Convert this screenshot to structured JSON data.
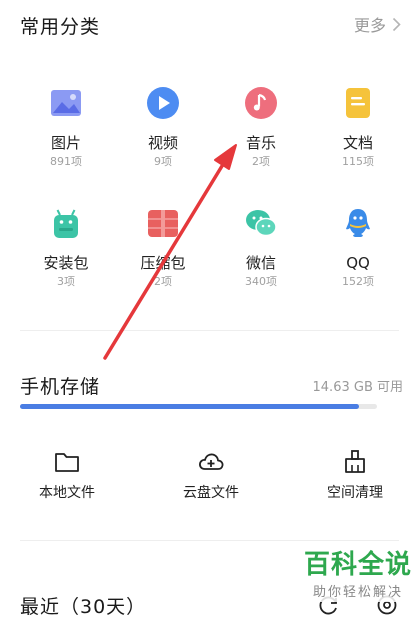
{
  "categories": {
    "title": "常用分类",
    "more_label": "更多",
    "items": [
      {
        "label": "图片",
        "count": "891项",
        "color": "#7a8cf0"
      },
      {
        "label": "视频",
        "count": "9项",
        "color": "#4d8cf2"
      },
      {
        "label": "音乐",
        "count": "2项",
        "color": "#ef5b6c"
      },
      {
        "label": "文档",
        "count": "115项",
        "color": "#f5c33b"
      },
      {
        "label": "安装包",
        "count": "3项",
        "color": "#3cc4a6"
      },
      {
        "label": "压缩包",
        "count": "2项",
        "color": "#e8605f"
      },
      {
        "label": "微信",
        "count": "340项",
        "color": "#3cc4a6"
      },
      {
        "label": "QQ",
        "count": "152项",
        "color": "#3a8be8"
      }
    ]
  },
  "storage": {
    "title": "手机存储",
    "available": "14.63 GB 可用",
    "used_fraction": 0.95,
    "bar_color": "#4a7de3"
  },
  "tools": [
    {
      "label": "本地文件"
    },
    {
      "label": "云盘文件"
    },
    {
      "label": "空间清理"
    }
  ],
  "recent": {
    "title": "最近（30天）"
  },
  "watermark": {
    "main": "百科全说",
    "sub": "助你轻松解决"
  }
}
